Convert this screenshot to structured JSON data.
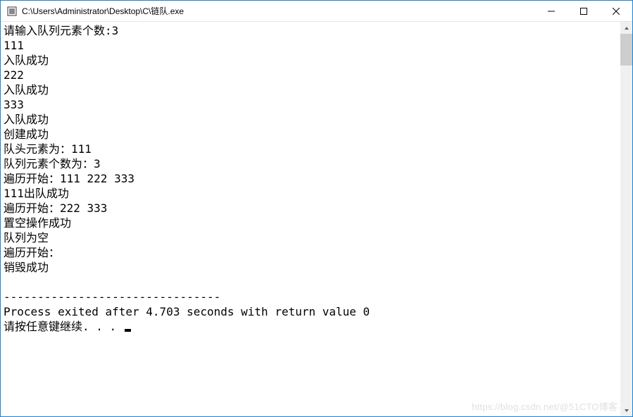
{
  "window": {
    "title": "C:\\Users\\Administrator\\Desktop\\C\\链队.exe"
  },
  "console": {
    "lines": [
      "请输入队列元素个数:3",
      "111",
      "入队成功",
      "222",
      "入队成功",
      "333",
      "入队成功",
      "创建成功",
      "队头元素为：111",
      "队列元素个数为：3",
      "遍历开始：111 222 333",
      "111出队成功",
      "遍历开始：222 333",
      "置空操作成功",
      "队列为空",
      "遍历开始：",
      "销毁成功",
      "",
      "--------------------------------",
      "Process exited after 4.703 seconds with return value 0"
    ],
    "prompt": "请按任意键继续. . . "
  },
  "watermark": "https://blog.csdn.net/@51CTO博客"
}
